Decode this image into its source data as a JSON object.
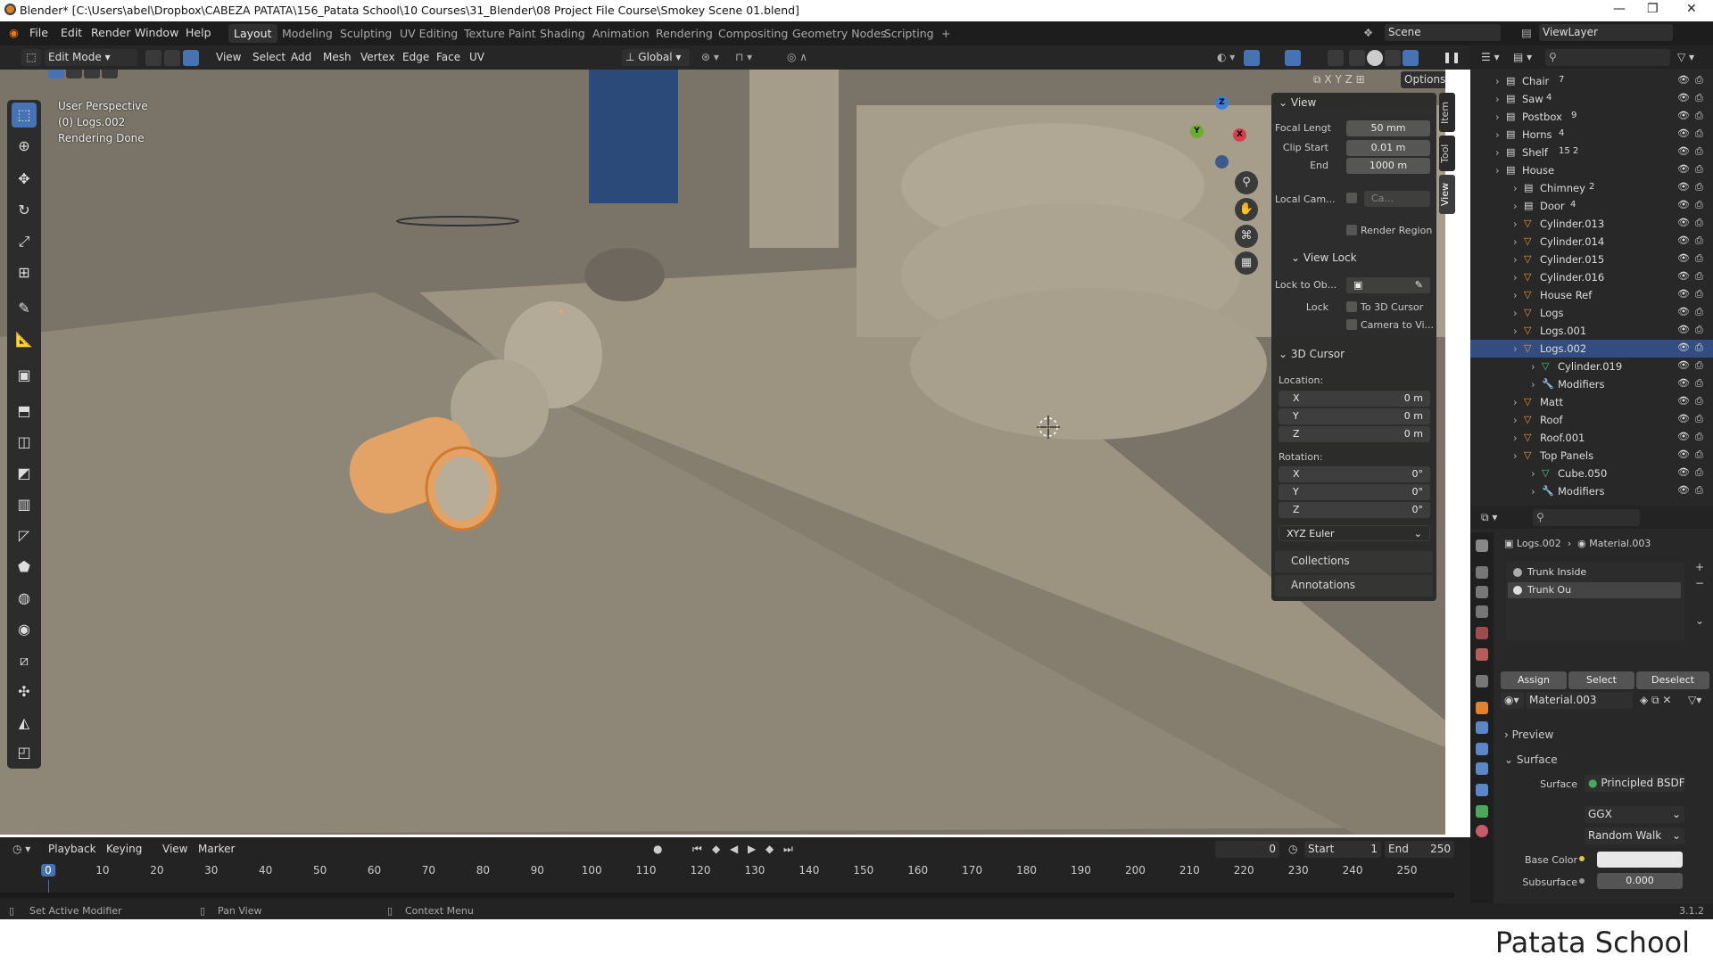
{
  "window": {
    "title": "Blender* [C:\\Users\\abel\\Dropbox\\CABEZA PATATA\\156_Patata School\\10 Courses\\31_Blender\\08 Project File Course\\Smokey Scene 01.blend]",
    "minimize": "—",
    "maximize": "❐",
    "close": "✕"
  },
  "menu": {
    "items": [
      "File",
      "Edit",
      "Render",
      "Window",
      "Help"
    ],
    "workspaces": [
      "Layout",
      "Modeling",
      "Sculpting",
      "UV Editing",
      "Texture Paint",
      "Shading",
      "Animation",
      "Rendering",
      "Compositing",
      "Geometry Nodes",
      "Scripting",
      "+"
    ],
    "active_workspace": "Layout",
    "scene": "Scene",
    "view_layer": "ViewLayer"
  },
  "header3d": {
    "mode": "Edit Mode",
    "menus": [
      "View",
      "Select",
      "Add",
      "Mesh",
      "Vertex",
      "Edge",
      "Face",
      "UV"
    ],
    "orientation": "Global",
    "options": "Options",
    "axes": [
      "X",
      "Y",
      "Z"
    ]
  },
  "viewport": {
    "perspective": "User Perspective",
    "object": "(0) Logs.002",
    "status": "Rendering Done"
  },
  "npanel": {
    "tabs": [
      "Item",
      "Tool",
      "View"
    ],
    "active_tab": "View",
    "view_header": "View",
    "focal_label": "Focal Lengt",
    "focal": "50 mm",
    "clip_start_label": "Clip Start",
    "clip_start": "0.01 m",
    "end_label": "End",
    "clip_end": "1000 m",
    "local_cam_label": "Local Cam...",
    "local_cam_value": "Ca...",
    "render_region": "Render Region",
    "view_lock": "View Lock",
    "lock_to_obj": "Lock to Ob...",
    "lock_label": "Lock",
    "to_3d_cursor": "To 3D Cursor",
    "camera_to_view": "Camera to Vi...",
    "cursor_header": "3D Cursor",
    "location": "Location:",
    "rotation": "Rotation:",
    "loc": [
      {
        "axis": "X",
        "value": "0 m"
      },
      {
        "axis": "Y",
        "value": "0 m"
      },
      {
        "axis": "Z",
        "value": "0 m"
      }
    ],
    "rot": [
      {
        "axis": "X",
        "value": "0°"
      },
      {
        "axis": "Y",
        "value": "0°"
      },
      {
        "axis": "Z",
        "value": "0°"
      }
    ],
    "rot_mode": "XYZ Euler",
    "collections": "Collections",
    "annotations": "Annotations"
  },
  "outliner": {
    "rows": [
      {
        "name": "Chair",
        "count": "7",
        "type": "collection"
      },
      {
        "name": "Saw",
        "count": "4",
        "type": "collection"
      },
      {
        "name": "Postbox",
        "count": "9",
        "type": "collection"
      },
      {
        "name": "Horns",
        "count": "4",
        "type": "collection"
      },
      {
        "name": "Shelf",
        "count": "15 2",
        "type": "collection"
      },
      {
        "name": "House",
        "count": "",
        "type": "collection"
      },
      {
        "name": "Chimney",
        "count": "2",
        "type": "collection"
      },
      {
        "name": "Door",
        "count": "4",
        "type": "collection"
      },
      {
        "name": "Cylinder.013",
        "count": "",
        "type": "mesh"
      },
      {
        "name": "Cylinder.014",
        "count": "",
        "type": "mesh"
      },
      {
        "name": "Cylinder.015",
        "count": "",
        "type": "mesh"
      },
      {
        "name": "Cylinder.016",
        "count": "",
        "type": "mesh"
      },
      {
        "name": "House Ref",
        "count": "",
        "type": "mesh"
      },
      {
        "name": "Logs",
        "count": "",
        "type": "mesh"
      },
      {
        "name": "Logs.001",
        "count": "",
        "type": "mesh"
      },
      {
        "name": "Logs.002",
        "count": "",
        "type": "mesh"
      },
      {
        "name": "Cylinder.019",
        "count": "",
        "type": "data"
      },
      {
        "name": "Modifiers",
        "count": "",
        "type": "mod"
      },
      {
        "name": "Matt",
        "count": "",
        "type": "mesh"
      },
      {
        "name": "Roof",
        "count": "",
        "type": "mesh"
      },
      {
        "name": "Roof.001",
        "count": "",
        "type": "mesh"
      },
      {
        "name": "Top Panels",
        "count": "",
        "type": "mesh"
      },
      {
        "name": "Cube.050",
        "count": "",
        "type": "data"
      },
      {
        "name": "Modifiers",
        "count": "",
        "type": "mod"
      }
    ],
    "selected": "Logs.002"
  },
  "properties": {
    "breadcrumb_obj": "Logs.002",
    "breadcrumb_mat": "Material.003",
    "slots": [
      "Trunk Inside",
      "Trunk Ou"
    ],
    "assign": "Assign",
    "select": "Select",
    "deselect": "Deselect",
    "material": "Material.003",
    "preview": "Preview",
    "surface": "Surface",
    "surface_label": "Surface",
    "shader": "Principled BSDF",
    "distribution": "GGX",
    "subsurface_method": "Random Walk",
    "base_color_label": "Base Color",
    "subsurface_label": "Subsurface",
    "subsurface_value": "0.000"
  },
  "timeline": {
    "menus": [
      "Playback",
      "Keying",
      "View",
      "Marker"
    ],
    "frame": "0",
    "start_label": "Start",
    "start": "1",
    "end_label": "End",
    "end": "250",
    "ticks": [
      "0",
      "10",
      "20",
      "30",
      "40",
      "50",
      "60",
      "70",
      "80",
      "90",
      "100",
      "110",
      "120",
      "130",
      "140",
      "150",
      "160",
      "170",
      "180",
      "190",
      "200",
      "210",
      "220",
      "230",
      "240",
      "250"
    ]
  },
  "status": {
    "left": "Set Active Modifier",
    "mid": "Pan View",
    "right": "Context Menu",
    "version": "3.1.2"
  },
  "brand": "Patata School"
}
